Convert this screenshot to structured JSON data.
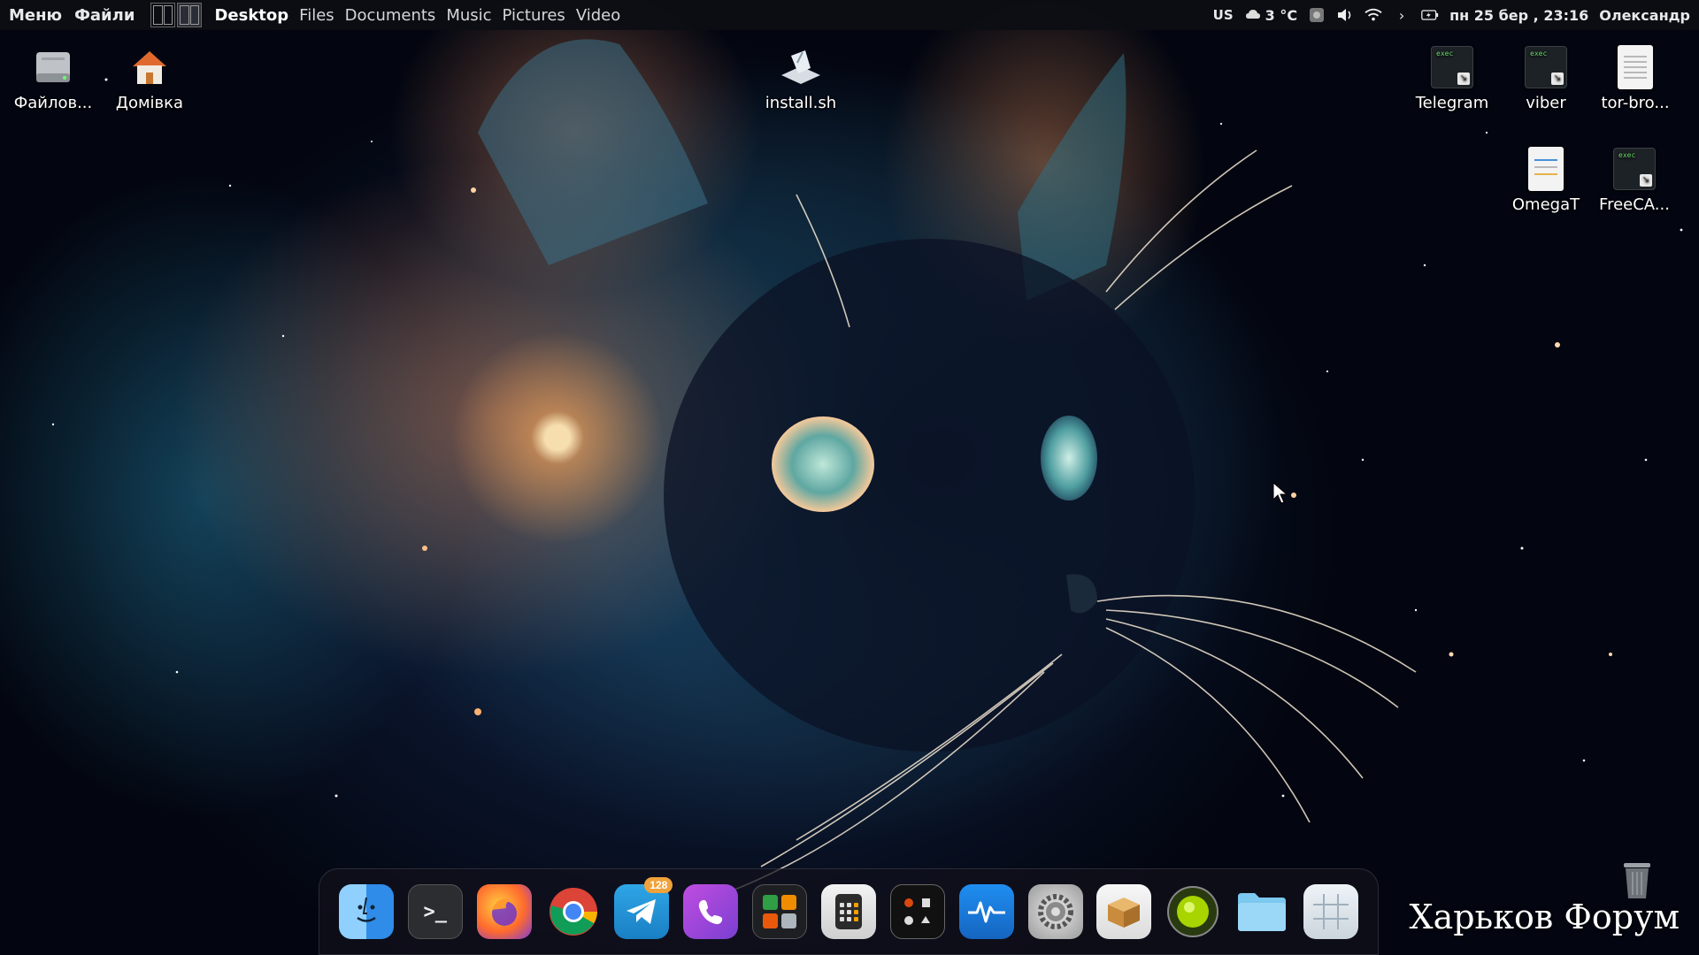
{
  "top_panel": {
    "menu_label": "Меню",
    "files_label": "Файли",
    "places": [
      {
        "label": "Desktop",
        "active": true
      },
      {
        "label": "Files",
        "active": false
      },
      {
        "label": "Documents",
        "active": false
      },
      {
        "label": "Music",
        "active": false
      },
      {
        "label": "Pictures",
        "active": false
      },
      {
        "label": "Video",
        "active": false
      }
    ],
    "tray": {
      "keyboard_layout": "US",
      "temperature": "3 °C",
      "datetime": "пн 25 бер , 23:16",
      "user": "Олександр"
    }
  },
  "desktop_icons": {
    "filesystem": "Файлов...",
    "home": "Домівка",
    "install": "install.sh",
    "telegram": "Telegram",
    "viber": "viber",
    "tor": "tor-bro...",
    "omegat": "OmegaT",
    "freecad": "FreeCA...",
    "exec_tag": "exec"
  },
  "dock": {
    "telegram_badge": "128"
  },
  "watermark": "Харьков Форум",
  "colors": {
    "panel_bg": "#0c0e14",
    "dock_bg": "#12101c",
    "badge": "#f0a23b"
  }
}
